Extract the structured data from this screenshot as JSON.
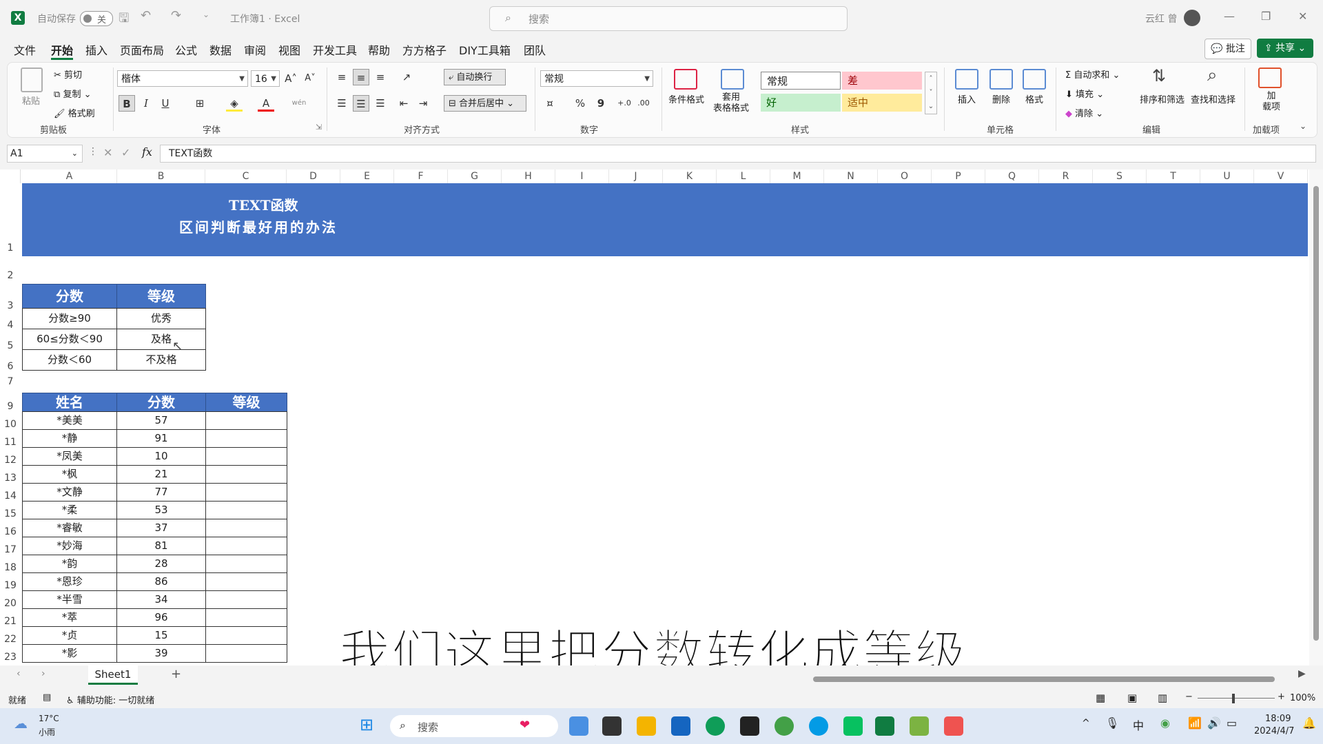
{
  "titlebar": {
    "autosave_label": "自动保存",
    "autosave_state": "关",
    "doc_title": "工作簿1 · Excel",
    "search_placeholder": "搜索",
    "user": "云红 曾",
    "app_badge": "X"
  },
  "menu": [
    "文件",
    "开始",
    "插入",
    "页面布局",
    "公式",
    "数据",
    "审阅",
    "视图",
    "开发工具",
    "帮助",
    "方方格子",
    "DIY工具箱",
    "团队"
  ],
  "menu_right": {
    "comment": "批注",
    "share": "共享"
  },
  "ribbon": {
    "clipboard": {
      "paste": "粘贴",
      "cut": "剪切",
      "copy": "复制",
      "painter": "格式刷",
      "label": "剪贴板"
    },
    "font": {
      "name": "楷体",
      "size": "16",
      "grow": "A",
      "shrink": "A",
      "bold": "B",
      "italic": "I",
      "underline": "U",
      "label": "字体",
      "phonetic": "wén"
    },
    "align": {
      "wrap": "自动换行",
      "merge": "合并后居中",
      "label": "对齐方式"
    },
    "number": {
      "format": "常规",
      "percent": "%",
      "comma": "9",
      "label": "数字"
    },
    "styles": {
      "cond": "条件格式",
      "table": "套用\n表格格式",
      "normal": "常规",
      "bad": "差",
      "good": "好",
      "neutral": "适中",
      "label": "样式"
    },
    "cells": {
      "insert": "插入",
      "delete": "删除",
      "format": "格式",
      "label": "单元格"
    },
    "edit": {
      "autosum": "自动求和",
      "fill": "填充",
      "clear": "清除",
      "sort": "排序和筛选",
      "find": "查找和选择",
      "label": "编辑"
    },
    "addins": {
      "addin": "加\n载项",
      "label": "加载项"
    }
  },
  "formula_bar": {
    "name_box": "A1",
    "fx": "fx",
    "content": "TEXT函数"
  },
  "columns": [
    "A",
    "B",
    "C",
    "D",
    "E",
    "F",
    "G",
    "H",
    "I",
    "J",
    "K",
    "L",
    "M",
    "N",
    "O",
    "P",
    "Q",
    "R",
    "S",
    "T",
    "U",
    "V"
  ],
  "sheet": {
    "title1": "TEXT函数",
    "title2": "区间判断最好用的办法",
    "lookup_headers": [
      "分数",
      "等级"
    ],
    "lookup_rows": [
      [
        "分数≥90",
        "优秀"
      ],
      [
        "60≤分数＜90",
        "及格"
      ],
      [
        "分数＜60",
        "不及格"
      ]
    ],
    "data_headers": [
      "姓名",
      "分数",
      "等级"
    ],
    "data_rows": [
      [
        "*美美",
        "57",
        ""
      ],
      [
        "*静",
        "91",
        ""
      ],
      [
        "*凤美",
        "10",
        ""
      ],
      [
        "*枫",
        "21",
        ""
      ],
      [
        "*文静",
        "77",
        ""
      ],
      [
        "*柔",
        "53",
        ""
      ],
      [
        "*睿敏",
        "37",
        ""
      ],
      [
        "*妙海",
        "81",
        ""
      ],
      [
        "*韵",
        "28",
        ""
      ],
      [
        "*恩珍",
        "86",
        ""
      ],
      [
        "*半雪",
        "34",
        ""
      ],
      [
        "*萃",
        "96",
        ""
      ],
      [
        "*贞",
        "15",
        ""
      ],
      [
        "*影",
        "39",
        ""
      ]
    ],
    "row_numbers": [
      "1",
      "2",
      "3",
      "4",
      "5",
      "6",
      "7",
      "9",
      "10",
      "11",
      "12",
      "13",
      "14",
      "15",
      "16",
      "17",
      "18",
      "19",
      "20",
      "21",
      "22",
      "23"
    ]
  },
  "caption": "我们这里把分数转化成等级",
  "tabs": {
    "sheet1": "Sheet1",
    "add": "+"
  },
  "status": {
    "ready": "就绪",
    "accessibility": "辅助功能: 一切就绪",
    "zoom": "100%"
  },
  "taskbar": {
    "temp": "17°C",
    "weather": "小雨",
    "search": "搜索",
    "time": "18:09",
    "date": "2024/4/7"
  }
}
